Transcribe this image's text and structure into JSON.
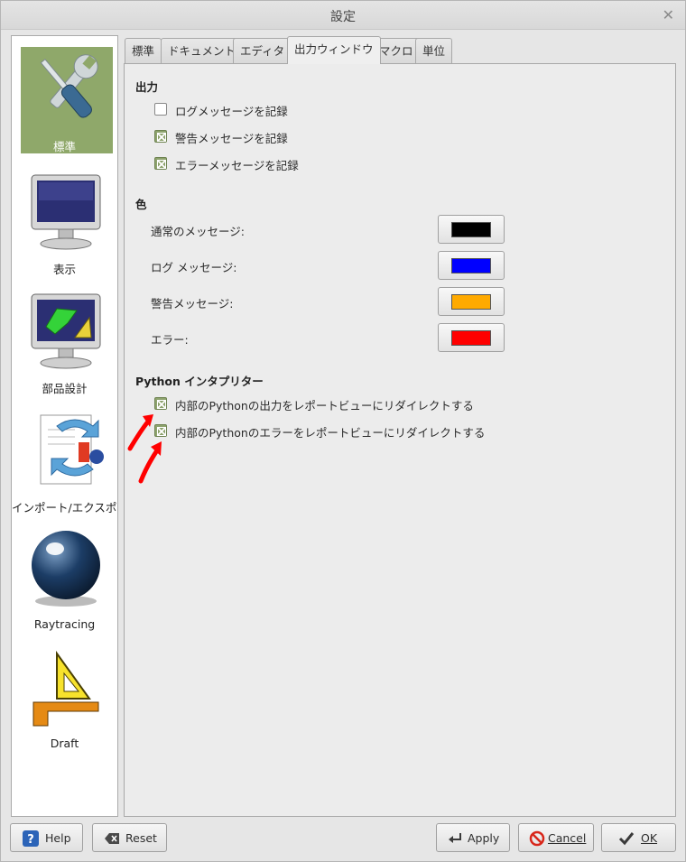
{
  "window": {
    "title": "設定"
  },
  "sidebar": {
    "items": [
      {
        "label": "標準",
        "icon": "tools-icon",
        "selected": true
      },
      {
        "label": "表示",
        "icon": "monitor-icon"
      },
      {
        "label": "部品設計",
        "icon": "part-design-icon"
      },
      {
        "label": "インポート/エクスポート",
        "icon": "import-export-icon"
      },
      {
        "label": "Raytracing",
        "icon": "raytracing-sphere-icon"
      },
      {
        "label": "Draft",
        "icon": "draft-icon"
      }
    ]
  },
  "tabs": [
    "標準",
    "ドキュメント",
    "エディタ",
    "出力ウィンドウ",
    "マクロ",
    "単位"
  ],
  "active_tab": "出力ウィンドウ",
  "output": {
    "title": "出力",
    "log_label": "ログメッセージを記録",
    "warn_label": "警告メッセージを記録",
    "error_label": "エラーメッセージを記録",
    "log_checked": false,
    "warn_checked": true,
    "error_checked": true
  },
  "colors": {
    "title": "色",
    "normal_label": "通常のメッセージ:",
    "log_label": "ログ メッセージ:",
    "warning_label": "警告メッセージ:",
    "error_label": "エラー:",
    "normal_color": "#000000",
    "log_color": "#0000ff",
    "warning_color": "#ffaa00",
    "error_color": "#ff0000"
  },
  "python": {
    "title": "Python インタプリター",
    "redirect_output_label": "内部のPythonの出力をレポートビューにリダイレクトする",
    "redirect_errors_label": "内部のPythonのエラーをレポートビューにリダイレクトする",
    "redirect_output_checked": true,
    "redirect_errors_checked": true
  },
  "buttons": {
    "help": "Help",
    "reset": "Reset",
    "apply": "Apply",
    "cancel": "Cancel",
    "ok": "OK"
  }
}
